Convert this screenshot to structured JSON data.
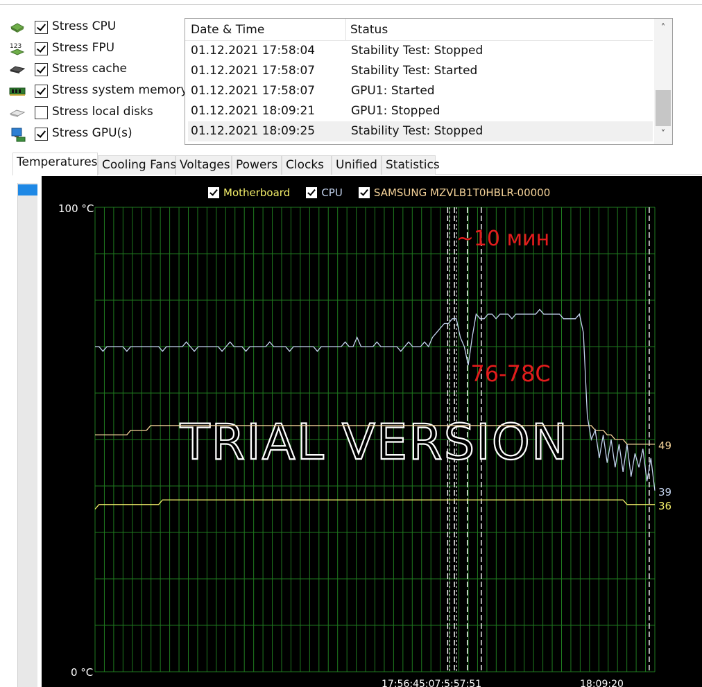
{
  "stress_options": [
    {
      "label": "Stress CPU",
      "checked": true,
      "icon": "cpu-chip-icon"
    },
    {
      "label": "Stress FPU",
      "checked": true,
      "icon": "fpu-123-icon"
    },
    {
      "label": "Stress cache",
      "checked": true,
      "icon": "cache-chip-icon"
    },
    {
      "label": "Stress system memory",
      "checked": true,
      "icon": "memory-module-icon"
    },
    {
      "label": "Stress local disks",
      "checked": false,
      "icon": "disk-drive-icon"
    },
    {
      "label": "Stress GPU(s)",
      "checked": true,
      "icon": "monitor-gpu-icon"
    }
  ],
  "log": {
    "columns": [
      "Date & Time",
      "Status"
    ],
    "rows": [
      {
        "time": "01.12.2021 17:58:04",
        "status": "Stability Test: Stopped"
      },
      {
        "time": "01.12.2021 17:58:07",
        "status": "Stability Test: Started"
      },
      {
        "time": "01.12.2021 17:58:07",
        "status": "GPU1: Started"
      },
      {
        "time": "01.12.2021 18:09:21",
        "status": "GPU1: Stopped"
      },
      {
        "time": "01.12.2021 18:09:25",
        "status": "Stability Test: Stopped"
      }
    ],
    "selected_index": 4
  },
  "tabs": [
    "Temperatures",
    "Cooling Fans",
    "Voltages",
    "Powers",
    "Clocks",
    "Unified",
    "Statistics"
  ],
  "active_tab": 0,
  "chart_data": {
    "type": "line",
    "legend": [
      {
        "name": "Motherboard",
        "color": "#f5f06a",
        "checked": true
      },
      {
        "name": "CPU",
        "color": "#c4d4ef",
        "checked": true
      },
      {
        "name": "SAMSUNG MZVLB1T0HBLR-00000",
        "color": "#f6d49a",
        "checked": true
      }
    ],
    "y_max_label": "100 °C",
    "y_min_label": "0 °C",
    "ylim": [
      0,
      100
    ],
    "x_tick_labels": [
      "17:58:04",
      "17:58:07",
      "18:09:20"
    ],
    "x_tick_overlap_text": "17:5​6:4​5:0​7:5​:5​7:51",
    "current_values": [
      {
        "series": "SAMSUNG MZVLB1T0HBLR-00000",
        "value": 49
      },
      {
        "series": "CPU",
        "value": 39
      },
      {
        "series": "Motherboard",
        "value": 36
      }
    ],
    "events_x_fraction": [
      0.63,
      0.642,
      0.665,
      0.69,
      0.99
    ],
    "watermark": "TRIAL VERSION",
    "annotations": [
      {
        "text": "~10 мин",
        "color": "#e31c1c"
      },
      {
        "text": "76-78C",
        "color": "#e31c1c"
      }
    ],
    "series": [
      {
        "name": "CPU",
        "samples_pct": [
          70,
          70,
          69,
          70,
          70,
          70,
          70,
          70,
          69,
          70,
          70,
          70,
          70,
          70,
          70,
          70,
          70,
          69,
          70,
          70,
          70,
          70,
          70,
          71,
          70,
          69,
          70,
          70,
          70,
          70,
          70,
          70,
          69,
          70,
          71,
          70,
          70,
          70,
          69,
          70,
          70,
          70,
          70,
          70,
          71,
          70,
          70,
          70,
          70,
          69,
          70,
          70,
          70,
          70,
          70,
          70,
          69,
          70,
          70,
          70,
          70,
          70,
          70,
          71,
          70,
          70,
          72,
          70,
          70,
          70,
          70,
          71,
          70,
          70,
          70,
          70,
          70,
          69,
          70,
          71,
          70,
          70,
          70,
          71,
          70,
          72,
          73,
          74,
          75,
          75,
          76,
          76,
          72,
          70,
          66,
          72,
          77,
          76,
          76,
          77,
          77,
          76,
          77,
          77,
          77,
          76,
          77,
          77,
          77,
          77,
          77,
          77,
          78,
          77,
          77,
          77,
          77,
          77,
          76,
          76,
          76,
          76,
          77,
          73,
          55,
          50,
          52,
          46,
          51,
          45,
          50,
          44,
          49,
          43,
          49,
          42,
          47,
          44,
          48,
          41,
          46,
          39
        ]
      },
      {
        "name": "SAMSUNG MZVLB1T0HBLR-00000",
        "samples_pct": [
          51,
          51,
          51,
          51,
          51,
          51,
          51,
          51,
          51,
          52,
          52,
          52,
          52,
          52,
          53,
          53,
          53,
          53,
          53,
          53,
          53,
          53,
          53,
          53,
          53,
          53,
          53,
          53,
          53,
          53,
          53,
          53,
          53,
          53,
          53,
          53,
          53,
          53,
          53,
          53,
          53,
          53,
          53,
          53,
          53,
          53,
          53,
          53,
          53,
          53,
          53,
          53,
          53,
          53,
          53,
          53,
          53,
          53,
          53,
          53,
          53,
          53,
          53,
          53,
          53,
          53,
          53,
          53,
          53,
          53,
          53,
          53,
          53,
          53,
          53,
          53,
          53,
          53,
          53,
          53,
          53,
          53,
          53,
          53,
          53,
          53,
          53,
          53,
          53,
          53,
          53,
          53,
          53,
          53,
          53,
          53,
          53,
          53,
          53,
          53,
          53,
          53,
          53,
          53,
          53,
          53,
          53,
          53,
          53,
          53,
          53,
          53,
          53,
          53,
          53,
          53,
          53,
          53,
          53,
          53,
          53,
          53,
          53,
          53,
          53,
          53,
          52,
          52,
          52,
          51,
          51,
          50,
          50,
          50,
          49,
          49,
          49,
          49,
          49,
          49,
          49,
          49
        ]
      },
      {
        "name": "Motherboard",
        "samples_pct": [
          35,
          36,
          36,
          36,
          36,
          36,
          36,
          36,
          36,
          36,
          36,
          36,
          36,
          36,
          36,
          36,
          36,
          37,
          37,
          37,
          37,
          37,
          37,
          37,
          37,
          37,
          37,
          37,
          37,
          37,
          37,
          37,
          37,
          37,
          37,
          37,
          37,
          37,
          37,
          37,
          37,
          37,
          37,
          37,
          37,
          37,
          37,
          37,
          37,
          37,
          37,
          37,
          37,
          37,
          37,
          37,
          37,
          37,
          37,
          37,
          37,
          37,
          37,
          37,
          37,
          37,
          37,
          37,
          37,
          37,
          37,
          37,
          37,
          37,
          37,
          37,
          37,
          37,
          37,
          37,
          37,
          37,
          37,
          37,
          37,
          37,
          37,
          37,
          37,
          37,
          37,
          37,
          37,
          37,
          37,
          37,
          37,
          37,
          37,
          37,
          37,
          37,
          37,
          37,
          37,
          37,
          37,
          37,
          37,
          37,
          37,
          37,
          37,
          37,
          37,
          37,
          37,
          37,
          37,
          37,
          37,
          37,
          37,
          37,
          37,
          37,
          37,
          37,
          37,
          37,
          37,
          37,
          37,
          37,
          36,
          36,
          36,
          36,
          36,
          36,
          36,
          36
        ]
      }
    ]
  }
}
